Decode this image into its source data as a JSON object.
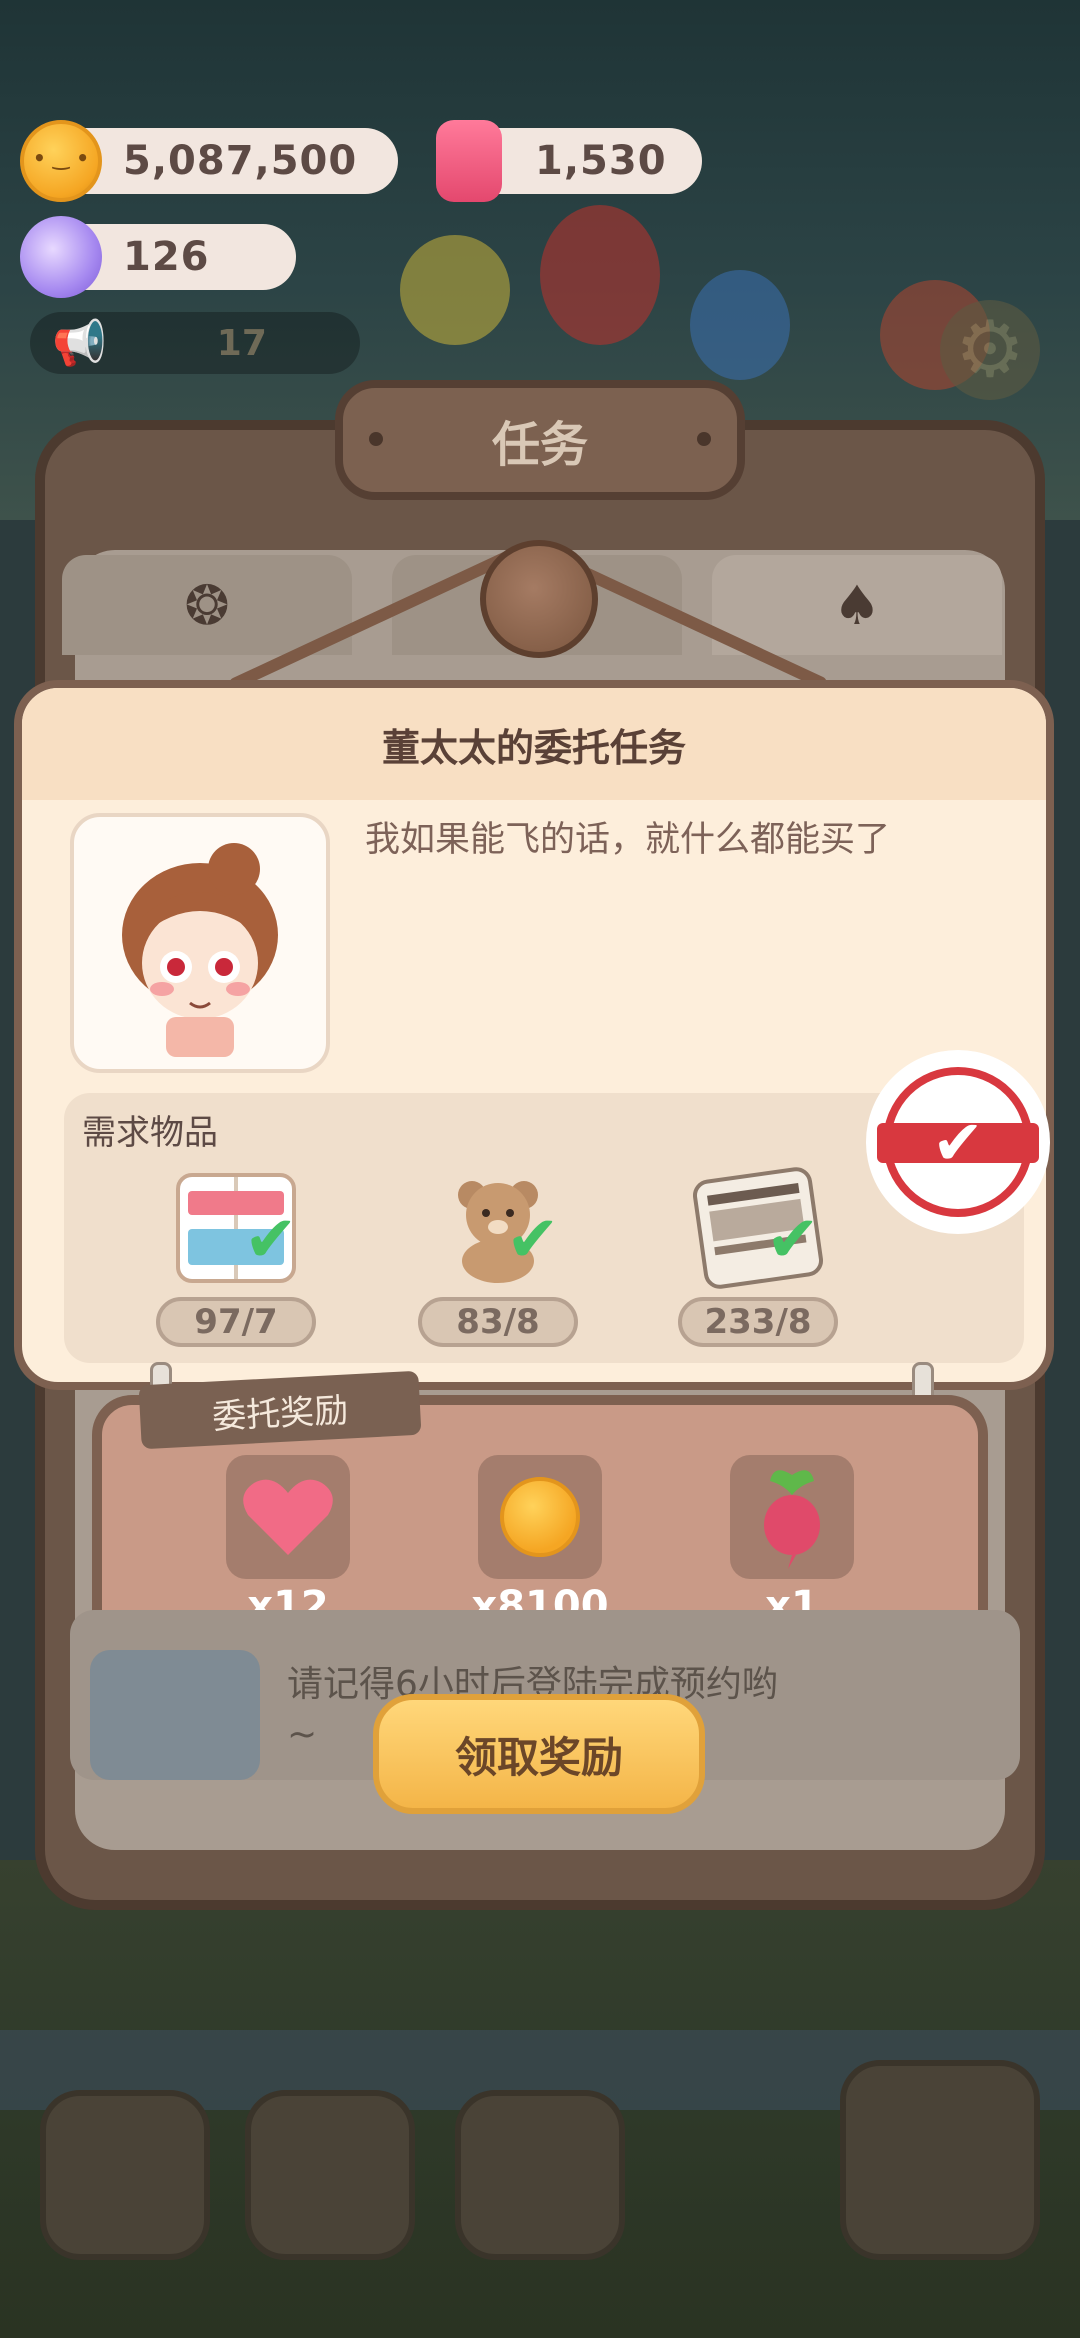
{
  "hud": {
    "coins": "5,087,500",
    "candles": "1,530",
    "candies": "126",
    "messages": "17"
  },
  "board": {
    "title": "任务"
  },
  "dialog": {
    "title": "董太太的委托任务",
    "quote": "我如果能飞的话，就什么都能买了",
    "requirements_label": "需求物品",
    "requirements": [
      {
        "icon": "magazine-icon",
        "count": "97/7"
      },
      {
        "icon": "teddy-bear-icon",
        "count": "83/8"
      },
      {
        "icon": "newspaper-icon",
        "count": "233/8"
      }
    ]
  },
  "reward": {
    "tag": "委托奖励",
    "items": [
      {
        "icon": "heart-icon",
        "amount": "x12"
      },
      {
        "icon": "cookie-coin-icon",
        "amount": "x8100"
      },
      {
        "icon": "radish-icon",
        "amount": "x1"
      }
    ]
  },
  "npc_note": "请记得6小时后登陆完成预约哟~",
  "claim_button": "领取奖励",
  "colors": {
    "accent_gold": "#f4b548",
    "check_green": "#45c264",
    "stamp_red": "#d8383f",
    "panel_brown": "#7d6050"
  }
}
